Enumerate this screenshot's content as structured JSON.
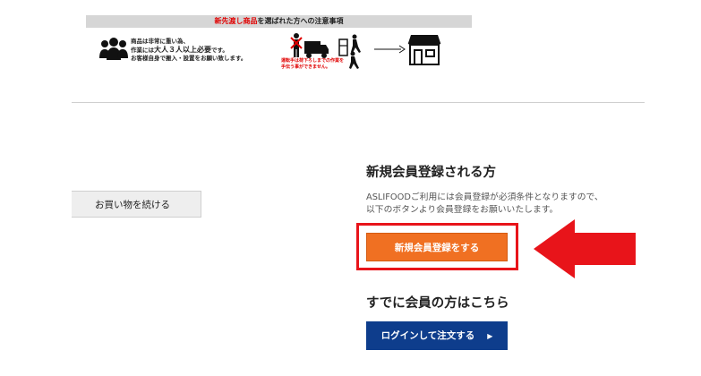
{
  "notice": {
    "header_red1": "新先渡し",
    "header_red2": "商品",
    "header_mid": "を選ばれた方への",
    "header_end": "注意事項",
    "line1": "商品は非常に重い為、",
    "line2_a": "作業には",
    "line2_b": "大人３人以上必要",
    "line2_c": "です。",
    "line3": "お客様自身で搬入・設置をお願い致します。",
    "truck_caption1": "運転手は荷下ろしまでの作業を",
    "truck_caption2": "手伝う事ができません。"
  },
  "continue_shopping": {
    "label": "お買い物を続ける"
  },
  "register": {
    "title": "新規会員登録される方",
    "desc_line1": "ASLIFOODご利用には会員登録が必須条件となりますので、",
    "desc_line2": "以下のボタンより会員登録をお願いいたします。",
    "button_label": "新規会員登録をする"
  },
  "member": {
    "title": "すでに会員の方はこちら",
    "login_label": "ログインして注文する",
    "login_chevron": "▶"
  },
  "colors": {
    "register_button": "#f07022",
    "login_button": "#0e3d8c",
    "highlight": "#e8141a"
  }
}
